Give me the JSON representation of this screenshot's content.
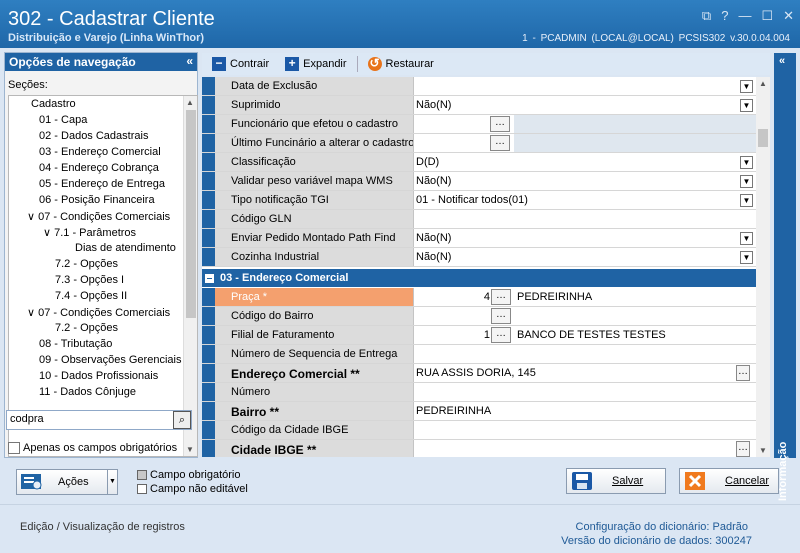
{
  "window": {
    "title": "302 - Cadastrar Cliente",
    "subtitle": "Distribuição e Varejo (Linha WinThor)",
    "status": "1 - PCADMIN (LOCAL@LOCAL)   PCSIS302  v.30.0.04.004"
  },
  "nav": {
    "header": "Opções de navegação",
    "sections_label": "Seções:",
    "items": [
      {
        "label": "Cadastro",
        "level": 0
      },
      {
        "label": "01 - Capa",
        "level": 1
      },
      {
        "label": "02 - Dados Cadastrais",
        "level": 1
      },
      {
        "label": "03 - Endereço Comercial",
        "level": 1
      },
      {
        "label": "04 - Endereço Cobrança",
        "level": 1
      },
      {
        "label": "05 - Endereço de Entrega",
        "level": 1
      },
      {
        "label": "06 - Posição Financeira",
        "level": 1
      },
      {
        "label": "07 - Condições Comerciais",
        "level": 1,
        "expanded": true
      },
      {
        "label": "7.1 - Parâmetros",
        "level": 2,
        "expanded": true
      },
      {
        "label": "Dias de atendimento",
        "level": 3
      },
      {
        "label": "7.2 - Opções",
        "level": 2
      },
      {
        "label": "7.3 - Opções I",
        "level": 2
      },
      {
        "label": "7.4 - Opções II",
        "level": 2
      },
      {
        "label": "07 - Condições Comerciais",
        "level": 1,
        "expanded": true
      },
      {
        "label": "7.2 - Opções",
        "level": 2
      },
      {
        "label": "08 - Tributação",
        "level": 1
      },
      {
        "label": "09 - Observações Gerenciais",
        "level": 1
      },
      {
        "label": "10 - Dados Profissionais",
        "level": 1
      },
      {
        "label": "11 - Dados Cônjuge",
        "level": 1
      }
    ],
    "search_value": "codpra",
    "only_required_label": "Apenas os campos obrigatórios"
  },
  "toolbar": {
    "collapse": "Contrair",
    "expand": "Expandir",
    "restore": "Restaurar"
  },
  "grid": {
    "rows1": [
      {
        "label": "Data de Exclusão",
        "value": "",
        "control": "dropdown"
      },
      {
        "label": "Suprimido",
        "value": "Não(N)",
        "control": "dropdown"
      },
      {
        "label": "Funcionário que efetou o cadastro",
        "value": "",
        "control": "ellipsis"
      },
      {
        "label": "Último Funcinário a alterar o cadastro",
        "value": "",
        "control": "ellipsis"
      },
      {
        "label": "Classificação",
        "value": "D(D)",
        "control": "dropdown"
      },
      {
        "label": "Validar peso variável mapa WMS",
        "value": "Não(N)",
        "control": "dropdown"
      },
      {
        "label": "Tipo notificação TGI",
        "value": "01 - Notificar todos(01)",
        "control": "dropdown"
      },
      {
        "label": "Código GLN",
        "value": "",
        "control": "none"
      },
      {
        "label": "Enviar Pedido Montado Path Find",
        "value": "Não(N)",
        "control": "dropdown"
      },
      {
        "label": "Cozinha Industrial",
        "value": "Não(N)",
        "control": "dropdown"
      }
    ],
    "section_title": "03 - Endereço Comercial",
    "rows2": [
      {
        "label": "Praça *",
        "code": "4",
        "desc": "PEDREIRINHA"
      },
      {
        "label": "Código do Bairro",
        "code": "",
        "desc": ""
      },
      {
        "label": "Filial de Faturamento",
        "code": "1",
        "desc": "BANCO DE TESTES TESTES"
      },
      {
        "label": "Número de Sequencia de Entrega",
        "value": ""
      },
      {
        "label": "Endereço Comercial **",
        "value": "RUA ASSIS DORIA, 145"
      },
      {
        "label": "Número",
        "value": ""
      },
      {
        "label": "Bairro **",
        "value": "PEDREIRINHA"
      },
      {
        "label": "Código da Cidade IBGE",
        "value": ""
      },
      {
        "label": "Cidade IBGE **",
        "value": ""
      }
    ]
  },
  "info_panel": {
    "label": "Informação"
  },
  "buttons": {
    "actions": "Ações",
    "save": "Salvar",
    "cancel": "Cancelar"
  },
  "legend": {
    "required": "Campo obrigatório",
    "readonly": "Campo não editável"
  },
  "footer": {
    "mode": "Edição / Visualização de registros",
    "dict_config_label": "Configuração do dicionário:",
    "dict_config_value": "Padrão",
    "dict_version_label": "Versão do dicionário de dados:",
    "dict_version_value": "300247"
  },
  "colors": {
    "accent": "#1f63a4",
    "required_field": "#f4a06e",
    "save_icon": "#1a58a6",
    "cancel_icon": "#f07a1e"
  }
}
